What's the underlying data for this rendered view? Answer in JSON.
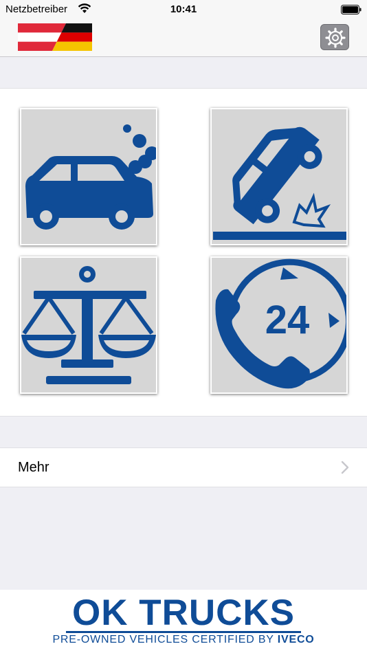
{
  "status_bar": {
    "carrier": "Netzbetreiber",
    "time": "10:41",
    "wifi_icon": "wifi-icon",
    "battery_icon": "battery-icon"
  },
  "nav_bar": {
    "flag_icon": "austria-germany-flag-icon",
    "settings_icon": "gear-icon"
  },
  "tiles": [
    {
      "icon": "car-breakdown-smoke-icon"
    },
    {
      "icon": "car-accident-overturned-icon"
    },
    {
      "icon": "legal-scales-icon"
    },
    {
      "icon": "phone-24h-service-icon"
    }
  ],
  "menu": {
    "more_label": "Mehr",
    "chevron_icon": "chevron-right-icon"
  },
  "footer": {
    "logo_title": "OK TRUCKS",
    "logo_subtitle_prefix": "PRE-OWNED VEHICLES CERTIFIED BY",
    "logo_subtitle_brand": "IVECO"
  },
  "colors": {
    "icon_blue": "#0f4c97",
    "tile_grey": "#d6d6d6",
    "background": "#efeff4"
  }
}
